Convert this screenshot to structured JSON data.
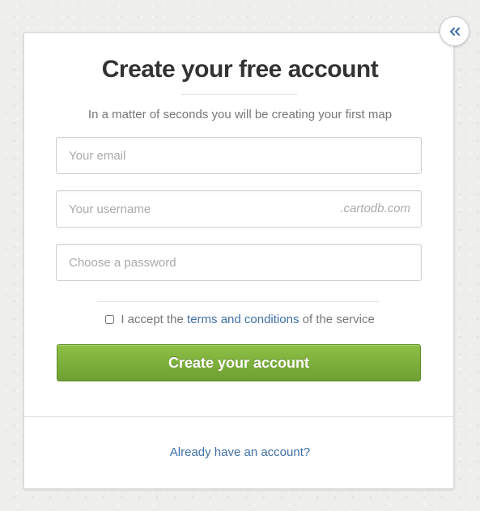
{
  "collapse_button": {
    "icon": "double-chevron-left-icon",
    "color": "#3f6fa7"
  },
  "form": {
    "title": "Create your free account",
    "subtitle": "In a matter of seconds you will be creating your first map",
    "email": {
      "value": "",
      "placeholder": "Your email"
    },
    "username": {
      "value": "",
      "placeholder": "Your username",
      "suffix": ".cartodb.com"
    },
    "password": {
      "value": "",
      "placeholder": "Choose a password"
    },
    "terms": {
      "checked": false,
      "prefix": "I accept the",
      "link_text": "terms and conditions",
      "suffix": "of the service"
    },
    "submit_label": "Create your account"
  },
  "footer": {
    "login_link": "Already have an account?"
  },
  "colors": {
    "accent_link": "#3f6fa7",
    "button_green": "#7aad3c",
    "title_text": "#333333",
    "muted_text": "#777777"
  }
}
